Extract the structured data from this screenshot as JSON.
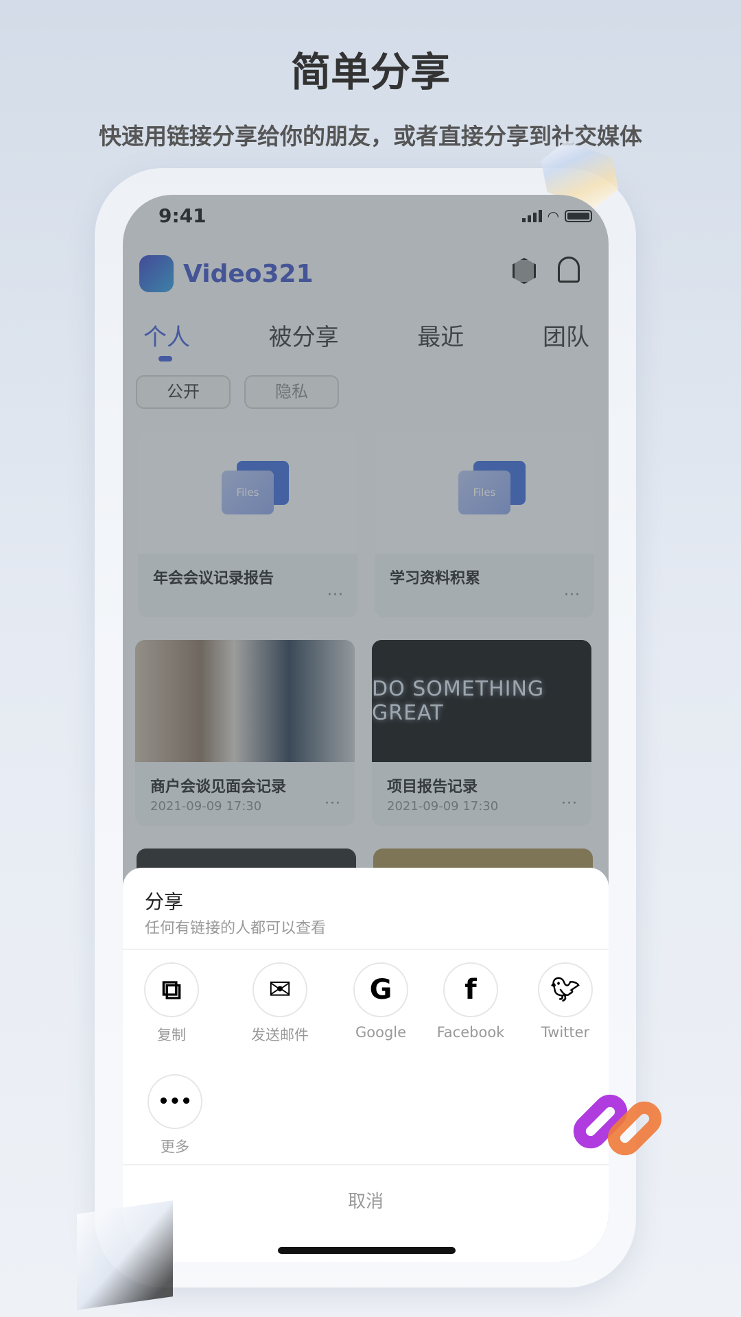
{
  "header": {
    "title": "简单分享",
    "subtitle": "快速用链接分享给你的朋友，或者直接分享到社交媒体"
  },
  "status": {
    "time": "9:41"
  },
  "app": {
    "name": "Video321",
    "icons": [
      "settings-icon",
      "bell-icon"
    ]
  },
  "tabs": [
    {
      "label": "个人",
      "active": true
    },
    {
      "label": "被分享"
    },
    {
      "label": "最近"
    },
    {
      "label": "团队"
    }
  ],
  "chips": [
    {
      "label": "公开",
      "active": true
    },
    {
      "label": "隐私"
    }
  ],
  "cards": [
    {
      "name": "年会会议记录报告",
      "thumb": "Files"
    },
    {
      "name": "学习资料积累",
      "thumb": "Files"
    },
    {
      "name": "商户会谈见面会记录",
      "date": "2021-09-09 17:30"
    },
    {
      "name": "项目报告记录",
      "date": "2021-09-09 17:30",
      "image_text": "DO SOMETHING GREAT"
    }
  ],
  "share": {
    "title": "分享",
    "subtitle": "任何有链接的人都可以查看",
    "options": [
      {
        "label": "复制",
        "icon": "copy-icon"
      },
      {
        "label": "发送邮件",
        "icon": "mail-icon"
      },
      {
        "label": "Google",
        "icon": "google-icon"
      },
      {
        "label": "Facebook",
        "icon": "facebook-icon"
      },
      {
        "label": "Twitter",
        "icon": "twitter-icon"
      },
      {
        "label": "更多",
        "icon": "more-icon"
      }
    ],
    "cancel": "取消"
  },
  "colors": {
    "accent": "#3f5ad8"
  }
}
